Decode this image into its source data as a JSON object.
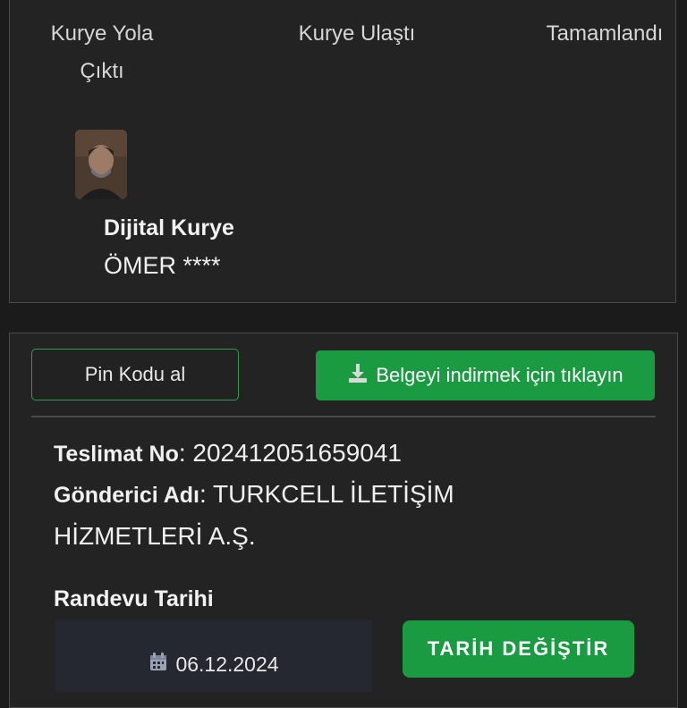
{
  "progress": {
    "steps": [
      "Kurye Yola Çıktı",
      "Kurye Ulaştı",
      "Tamamlandı"
    ]
  },
  "courier": {
    "title": "Dijital Kurye",
    "name": "ÖMER ****"
  },
  "actions": {
    "pin_label": "Pin Kodu al",
    "download_label": "Belgeyi indirmek için tıklayın"
  },
  "details": {
    "delivery_no_label": "Teslimat No",
    "delivery_no": "202412051659041",
    "sender_label": "Gönderici Adı",
    "sender": "TURKCELL İLETİŞİM HİZMETLERİ A.Ş."
  },
  "appointment": {
    "label": "Randevu Tarihi",
    "date": "06.12.2024",
    "change_label": "TARİH DEĞİŞTİR"
  },
  "colors": {
    "accent_green": "#1a9b41",
    "background": "#1b1b1b",
    "card": "#232323"
  },
  "icons": {
    "download": "download-icon",
    "calendar": "calendar-icon"
  }
}
